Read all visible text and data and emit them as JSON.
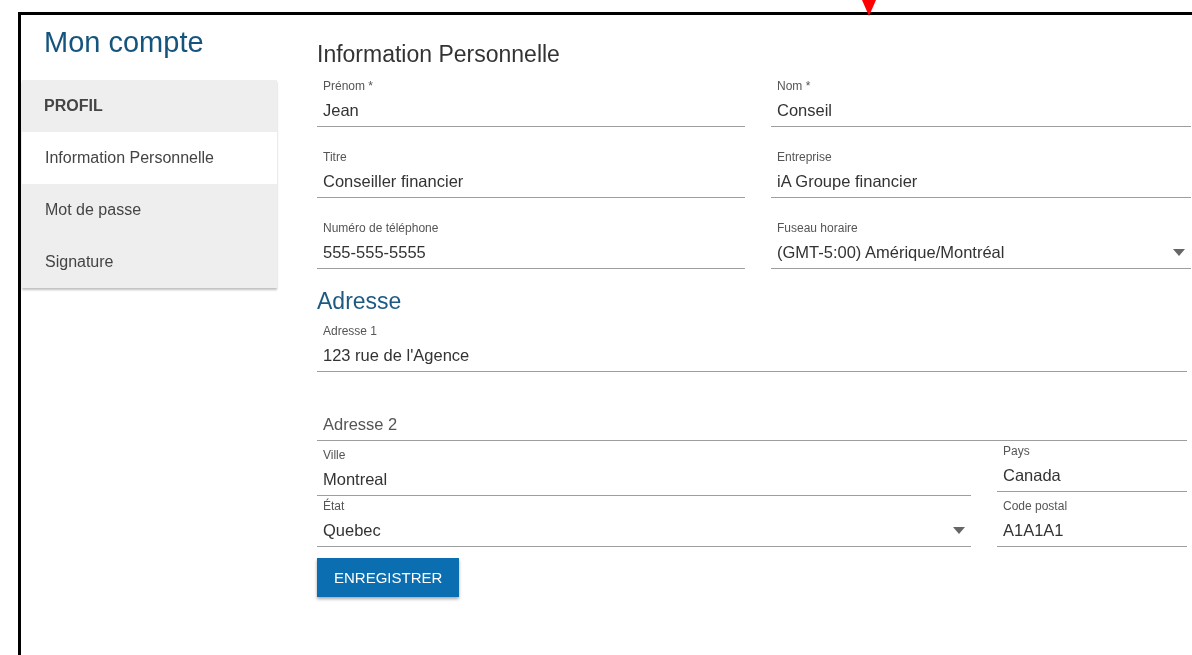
{
  "page_title": "Mon compte",
  "sidebar": {
    "section": "PROFIL",
    "items": [
      {
        "label": "Information Personnelle",
        "selected": true
      },
      {
        "label": "Mot de passe",
        "selected": false
      },
      {
        "label": "Signature",
        "selected": false
      }
    ]
  },
  "personal": {
    "heading": "Information Personnelle",
    "fields": [
      {
        "label": "Prénom *",
        "value": "Jean",
        "kind": "text"
      },
      {
        "label": "Nom *",
        "value": "Conseil",
        "kind": "text"
      },
      {
        "label": "Titre",
        "value": "Conseiller financier",
        "kind": "text"
      },
      {
        "label": "Entreprise",
        "value": "iA Groupe financier",
        "kind": "text"
      },
      {
        "label": "Numéro de téléphone",
        "value": "555-555-5555",
        "kind": "text"
      },
      {
        "label": "Fuseau horaire",
        "value": "(GMT-5:00) Amérique/Montréal",
        "kind": "select"
      }
    ]
  },
  "address": {
    "heading": "Adresse",
    "fields": [
      {
        "label": "Adresse 1",
        "value": "123 rue de l'Agence",
        "kind": "text"
      },
      {
        "placeholder": "Adresse 2",
        "kind": "text"
      },
      {
        "label": "Ville",
        "value": "Montreal",
        "kind": "text"
      },
      {
        "label": "Pays",
        "value": "Canada",
        "kind": "text"
      },
      {
        "label": "État",
        "value": "Quebec",
        "kind": "select"
      },
      {
        "label": "Code postal",
        "value": "A1A1A1",
        "kind": "text"
      }
    ]
  },
  "save_button": "ENREGISTRER"
}
